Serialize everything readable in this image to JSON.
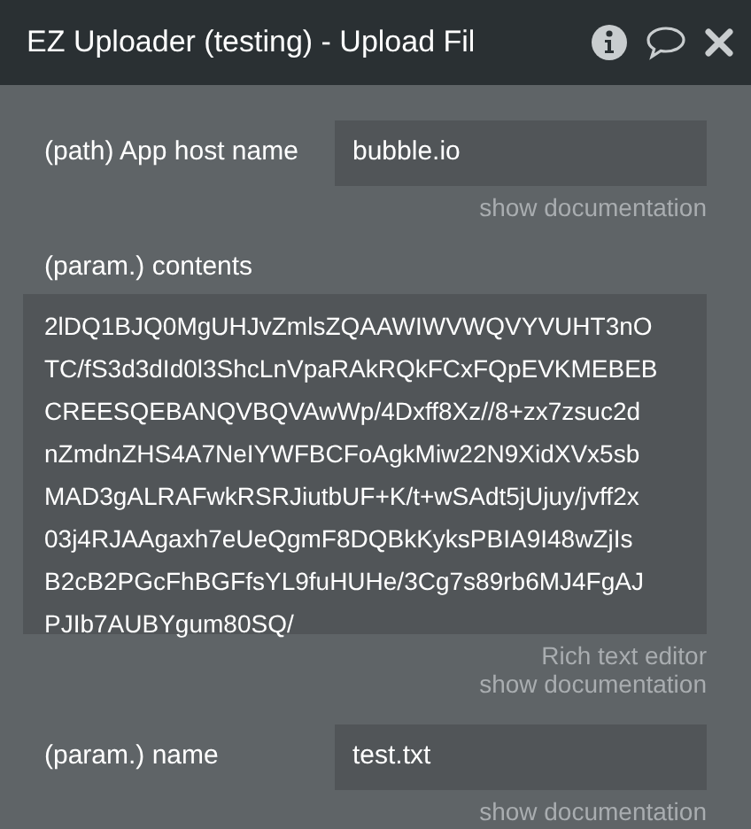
{
  "window": {
    "title": "EZ Uploader (testing) - Upload Fil"
  },
  "fields": [
    {
      "kind": "inline",
      "label": "(path) App host name",
      "value": "bubble.io",
      "links": [
        "show documentation"
      ]
    },
    {
      "kind": "block",
      "label": "(param.) contents",
      "value_lines": [
        "2lDQ1BJQ0MgUHJvZmlsZQAAWIWVWQVYVUHT3nO",
        "TC/fS3d3dId0l3ShcLnVpaRAkRQkFCxFQpEVKMEBEB",
        "CREESQEBANQVBQVAwWp/4Dxff8Xz//8+zx7zsuc2d",
        "nZmdnZHS4A7NeIYWFBCFoAgkMiw22N9XidXVx5sb",
        "MAD3gALRAFwkRSRJiutbUF+K/t+wSAdt5jUjuy/jvff2x",
        "03j4RJAAgaxh7eUeQgmF8DQBkKyksPBIA9I48wZjIs",
        "B2cB2PGcFhBGFfsYL9fuHUHe/3Cg7s89rb6MJ4FgAJ",
        "PJIb7AUBYgum80SQ/"
      ],
      "links": [
        "Rich text editor",
        "show documentation"
      ]
    },
    {
      "kind": "inline",
      "label": "(param.) name",
      "value": "test.txt",
      "links": [
        "show documentation"
      ]
    }
  ]
}
